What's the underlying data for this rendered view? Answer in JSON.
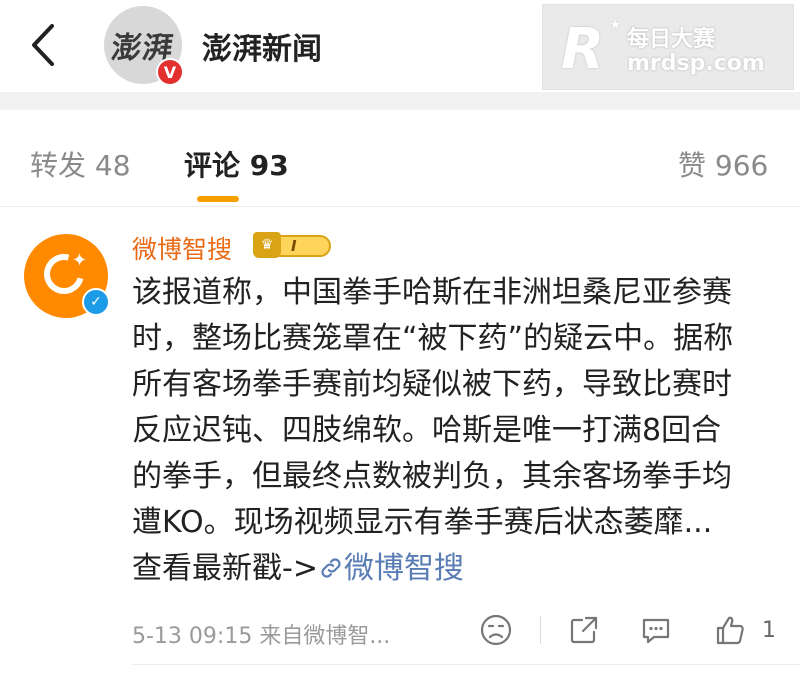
{
  "header": {
    "account_name": "澎湃新闻",
    "avatar_text": "澎湃",
    "verified_mark": "V"
  },
  "watermark": {
    "logo_letter": "R",
    "name": "每日大赛",
    "url": "mrdsp.com"
  },
  "tabs": [
    {
      "label": "转发 48",
      "active": false
    },
    {
      "label": "评论 93",
      "active": true
    },
    {
      "label": "赞 966",
      "active": false
    }
  ],
  "comment": {
    "author": "微博智搜",
    "level_badge": "I",
    "text_lines": [
      "该报道称，中国拳手哈斯在非洲坦桑尼亚参赛",
      "时，整场比赛笼罩在“被下药”的疑云中。据称",
      "所有客场拳手赛前均疑似被下药，导致比赛时",
      "反应迟钝、四肢绵软。哈斯是唯一打满8回合",
      "的拳手，但最终点数被判负，其余客场拳手均",
      "遭KO。现场视频显示有拳手赛后状态萎靡..."
    ],
    "more_prefix": "查看最新戳->",
    "more_link": "微博智搜",
    "meta": "5-13 09:15 来自微博智...",
    "like_count": "1"
  },
  "icons": {
    "back": "chevron-left-icon",
    "emoji": "sad-face-icon",
    "share": "share-icon",
    "reply": "comment-icon",
    "like": "thumbs-up-icon",
    "link": "link-icon"
  },
  "colors": {
    "accent": "#f7a000",
    "author": "#e86b17",
    "link": "#5a7cb4",
    "verified_red": "#e3302f",
    "verified_blue": "#1c9be8"
  }
}
